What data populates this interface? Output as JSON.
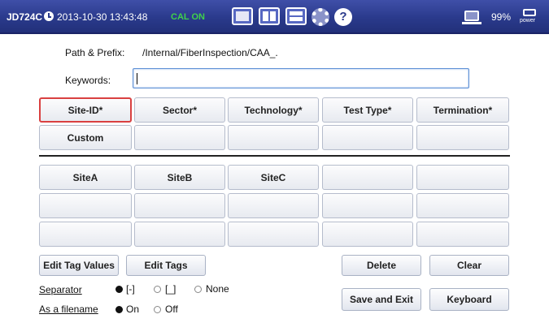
{
  "statusbar": {
    "model": "JD724C",
    "datetime": "2013-10-30 13:43:48",
    "cal_status": "CAL ON",
    "battery": "99%",
    "power_label": "power",
    "icons": [
      "clock-icon",
      "single-view-icon",
      "dual-view-icon",
      "split-view-icon",
      "gear-icon",
      "help-icon",
      "laptop-icon",
      "power-icon"
    ]
  },
  "path": {
    "label": "Path & Prefix:",
    "value": "/Internal/FiberInspection/CAA_."
  },
  "keywords": {
    "label": "Keywords:",
    "value": "",
    "placeholder": ""
  },
  "tags": {
    "row1": [
      "Site-ID*",
      "Sector*",
      "Technology*",
      "Test Type*",
      "Termination*"
    ],
    "row2": [
      "Custom",
      "",
      "",
      "",
      ""
    ],
    "selected": "Site-ID*"
  },
  "values": {
    "row1": [
      "SiteA",
      "SiteB",
      "SiteC",
      "",
      ""
    ],
    "row2": [
      "",
      "",
      "",
      "",
      ""
    ],
    "row3": [
      "",
      "",
      "",
      "",
      ""
    ]
  },
  "buttons": {
    "edit_tag_values": "Edit Tag Values",
    "edit_tags": "Edit Tags",
    "delete": "Delete",
    "clear": "Clear",
    "save_and_exit": "Save and Exit",
    "keyboard": "Keyboard"
  },
  "separator": {
    "label": "Separator",
    "options": [
      "[-]",
      "[_]",
      "None"
    ],
    "selected": "[-]"
  },
  "as_filename": {
    "label": "As a filename",
    "options": [
      "On",
      "Off"
    ],
    "selected": "On"
  }
}
